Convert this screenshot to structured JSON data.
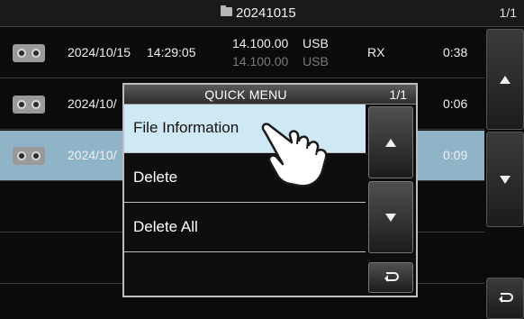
{
  "header": {
    "folder_name": "20241015",
    "page_indicator": "1/1",
    "folder_icon": "folder-icon"
  },
  "recordings": [
    {
      "date": "2024/10/15",
      "time": "14:29:05",
      "freq_primary": "14.100.00",
      "mode_primary": "USB",
      "freq_secondary": "14.100.00",
      "mode_secondary": "USB",
      "direction": "RX",
      "duration": "0:38",
      "icon": "recording-icon"
    },
    {
      "date": "2024/10/",
      "duration": "0:06",
      "icon": "recording-icon"
    },
    {
      "date": "2024/10/",
      "duration": "0:09",
      "icon": "recording-icon",
      "selected": true
    }
  ],
  "side_buttons": {
    "up_icon": "up-arrow-icon",
    "down_icon": "down-arrow-icon",
    "back_icon": "return-icon"
  },
  "quick_menu": {
    "title": "QUICK MENU",
    "page": "1/1",
    "items": [
      "File Information",
      "Delete",
      "Delete All"
    ],
    "highlighted_item": "File Information"
  },
  "colors": {
    "selected_row": "#8fb4c8",
    "menu_highlight": "#cfe9f4"
  },
  "pointer_icon": "hand-pointer-icon"
}
